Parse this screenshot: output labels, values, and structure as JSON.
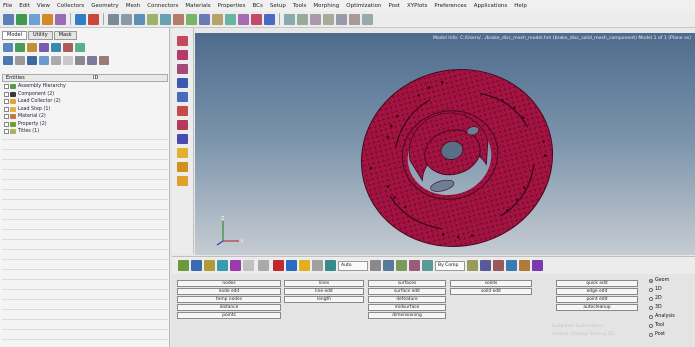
{
  "menu": [
    "File",
    "Edit",
    "View",
    "Collectors",
    "Geometry",
    "Mesh",
    "Connectors",
    "Materials",
    "Properties",
    "BCs",
    "Setup",
    "Tools",
    "Morphing",
    "Optimization",
    "Post",
    "XYPlots",
    "Preferences",
    "Applications",
    "Help"
  ],
  "left_panel": {
    "tabs": [
      "Model",
      "Utility",
      "Mask"
    ],
    "columns": [
      "Entities",
      "ID"
    ],
    "tree": [
      "Assembly Hierarchy",
      "Component (2)",
      "Load Collector (2)",
      "Load Step (1)",
      "Material (2)",
      "Property (2)",
      "Titles (1)"
    ]
  },
  "viewport": {
    "title": "Model Info: C:/Users/.../brake_disc_mesh_model.hm  (brake_disc_solid_mesh_component)  Model 1 of 1 (Plane vs)",
    "axes": {
      "x": "X",
      "y": "Y",
      "z": "Z"
    }
  },
  "bottom_toolbar": {
    "dropdown1": "Auto",
    "dropdown2": "By Comp"
  },
  "panel": {
    "col1": [
      "nodes",
      "node edit",
      "temp nodes",
      "distance",
      "points"
    ],
    "col2": [
      "lines",
      "line edit",
      "length"
    ],
    "col3": [
      "surfaces",
      "surface edit",
      "defeature",
      "midsurface",
      "dimensioning"
    ],
    "col4": [
      "solids",
      "solid edit"
    ],
    "col5": [
      "quick edit",
      "edge edit",
      "point edit",
      "autocleanup"
    ],
    "radios": [
      "Geom",
      "1D",
      "2D",
      "3D",
      "Analysis",
      "Tool",
      "Post"
    ],
    "radio_selected": "Geom",
    "ghost": [
      "Subpanel: Subsurfaces",
      "Control: Display: Editing 2D"
    ]
  },
  "colors": {
    "mesh": "#b5164a",
    "accent": "#4e6b8c"
  }
}
